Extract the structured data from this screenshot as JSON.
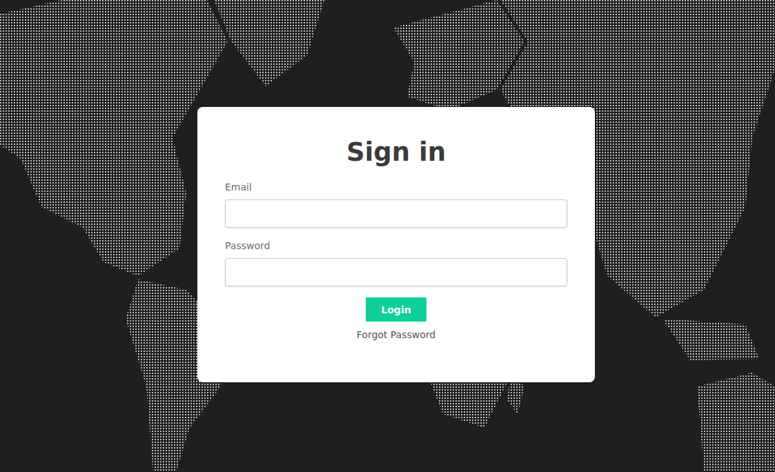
{
  "page": {
    "title": "Sign in"
  },
  "fields": [
    {
      "label": "Email",
      "value": "",
      "kind": "email"
    },
    {
      "label": "Password",
      "value": "",
      "kind": "password"
    }
  ],
  "buttons": [
    "Login"
  ],
  "links": [
    "Forgot Password"
  ]
}
